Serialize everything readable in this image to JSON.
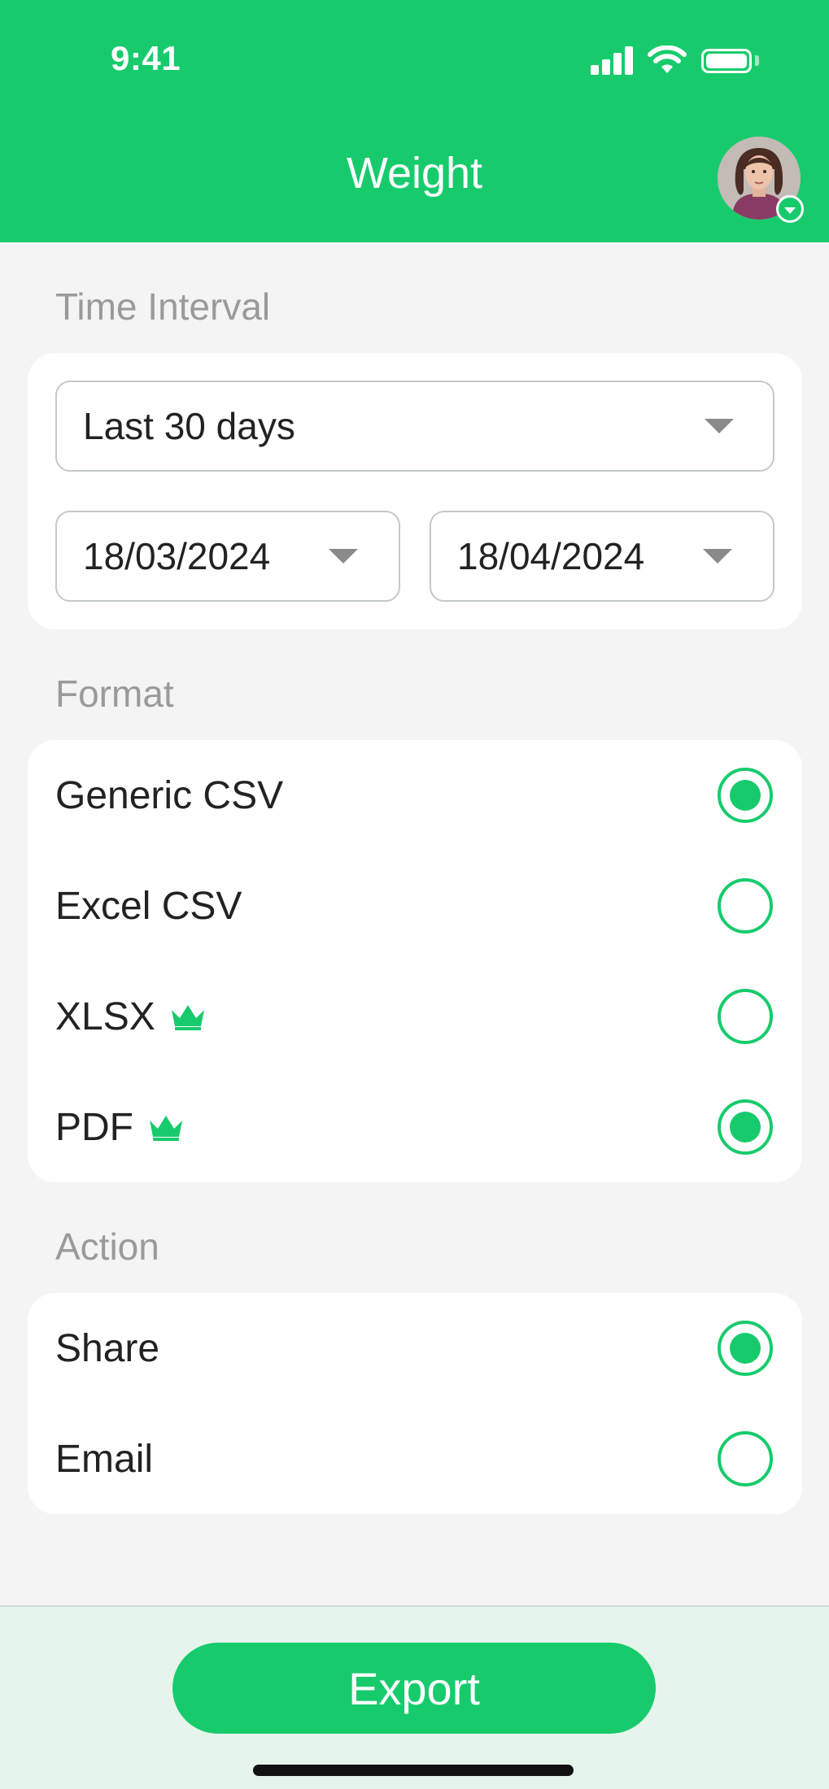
{
  "status_bar": {
    "time": "9:41"
  },
  "header": {
    "title": "Weight"
  },
  "time_interval": {
    "label": "Time Interval",
    "preset": "Last 30 days",
    "start_date": "18/03/2024",
    "end_date": "18/04/2024"
  },
  "format": {
    "label": "Format",
    "options": [
      {
        "label": "Generic CSV",
        "selected": true,
        "premium": false
      },
      {
        "label": "Excel CSV",
        "selected": false,
        "premium": false
      },
      {
        "label": "XLSX",
        "selected": false,
        "premium": true
      },
      {
        "label": "PDF",
        "selected": true,
        "premium": true
      }
    ]
  },
  "action": {
    "label": "Action",
    "options": [
      {
        "label": "Share",
        "selected": true
      },
      {
        "label": "Email",
        "selected": false
      }
    ]
  },
  "footer": {
    "export_label": "Export"
  },
  "colors": {
    "accent": "#17cb6c",
    "background": "#f4f4f4",
    "footer_bg": "#e6f5ec"
  }
}
